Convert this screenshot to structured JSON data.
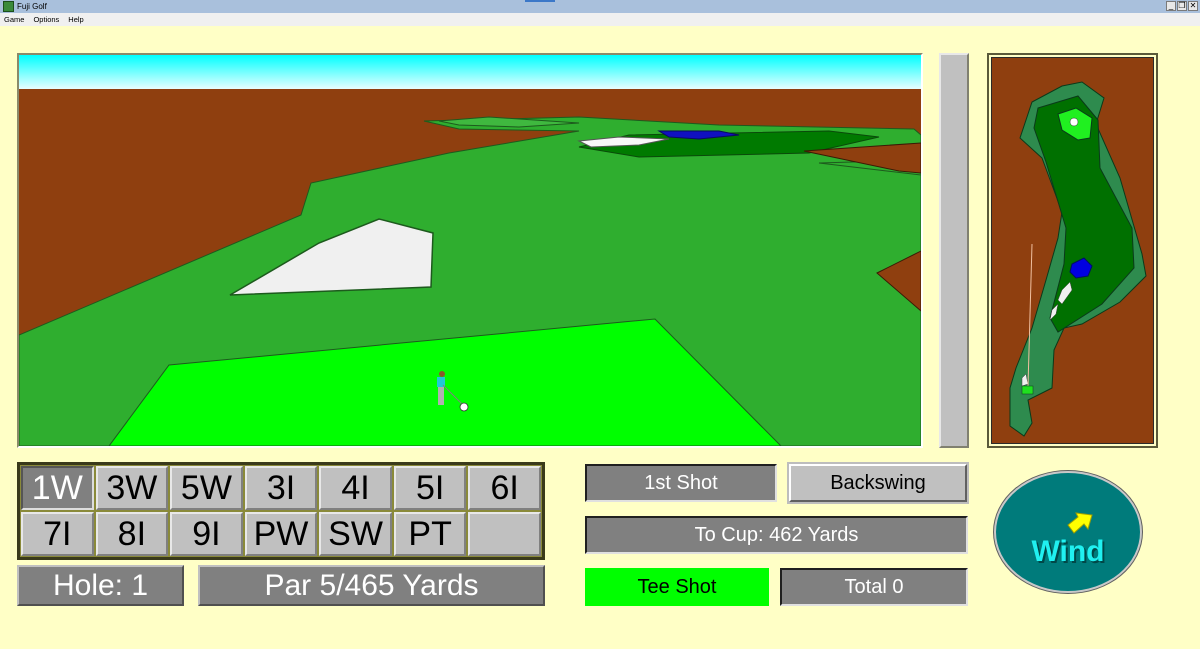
{
  "window": {
    "title": "Fuji Golf",
    "controls": {
      "minimize": "_",
      "restore": "❐",
      "close": "✕"
    }
  },
  "menu": [
    "Game",
    "Options",
    "Help"
  ],
  "clubs": [
    {
      "label": "1W",
      "selected": true
    },
    {
      "label": "3W",
      "selected": false
    },
    {
      "label": "5W",
      "selected": false
    },
    {
      "label": "3I",
      "selected": false
    },
    {
      "label": "4I",
      "selected": false
    },
    {
      "label": "5I",
      "selected": false
    },
    {
      "label": "6I",
      "selected": false
    },
    {
      "label": "7I",
      "selected": false
    },
    {
      "label": "8I",
      "selected": false
    },
    {
      "label": "9I",
      "selected": false
    },
    {
      "label": "PW",
      "selected": false
    },
    {
      "label": "SW",
      "selected": false
    },
    {
      "label": "PT",
      "selected": false
    },
    {
      "label": "",
      "selected": false
    }
  ],
  "hole": {
    "label": "Hole: 1",
    "par_info": "Par 5/465 Yards"
  },
  "status": {
    "shot": "1st Shot",
    "backswing_button": "Backswing",
    "to_cup": "To Cup: 462 Yards",
    "lie": "Tee Shot",
    "total": "Total 0"
  },
  "wind": {
    "label": "Wind",
    "arrow_color": "#ffff00"
  },
  "power_meter": {
    "level": 0
  },
  "colors": {
    "background": "#ffffc6",
    "rough": "#2fae2f",
    "fairway": "#008000",
    "tee": "#00ff00",
    "out_of_bounds": "#8f3f0f",
    "bunker": "#f0f0f0",
    "water": "#0000e0",
    "sky_top": "#00ffff",
    "sky_bottom": "#e8ffff",
    "wind_bg": "#007b7b",
    "wind_text": "#20f0f0"
  }
}
